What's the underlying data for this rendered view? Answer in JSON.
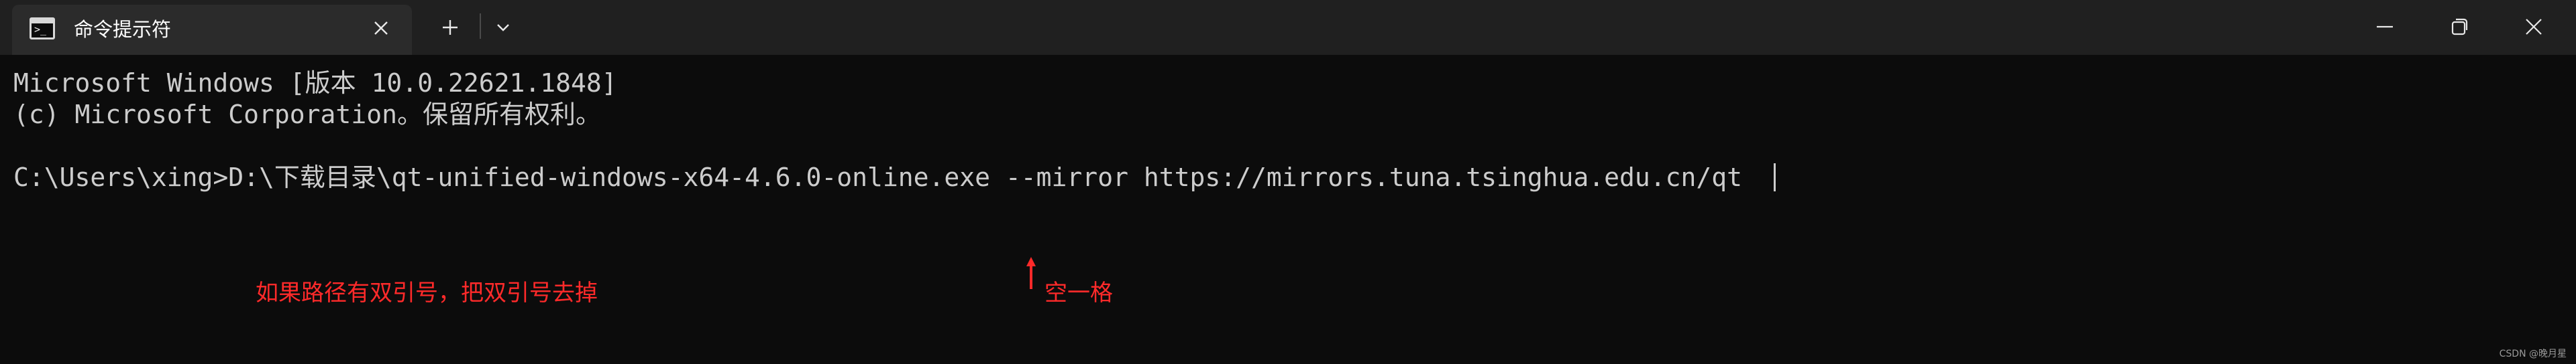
{
  "window": {
    "tab_title": "命令提示符",
    "tab_icon": "cmd-prompt-icon",
    "tab_icon_prompt": ">_",
    "tab_close_icon": "close-icon",
    "new_tab_icon": "plus-icon",
    "dropdown_icon": "chevron-down-icon",
    "controls": [
      "minimize-icon",
      "restore-icon",
      "close-icon"
    ]
  },
  "console": {
    "lines": [
      "Microsoft Windows [版本 10.0.22621.1848]",
      "(c) Microsoft Corporation。保留所有权利。",
      "",
      "C:\\Users\\xing>D:\\下载目录\\qt-unified-windows-x64-4.6.0-online.exe --mirror https://mirrors.tuna.tsinghua.edu.cn/qt"
    ],
    "text_color": "#cccccc",
    "background": "#0c0c0c"
  },
  "annotations": {
    "note_quotes": "如果路径有双引号，把双引号去掉",
    "note_space": "空一格",
    "color": "#ff2a2a"
  },
  "watermark": "CSDN @晚月星"
}
